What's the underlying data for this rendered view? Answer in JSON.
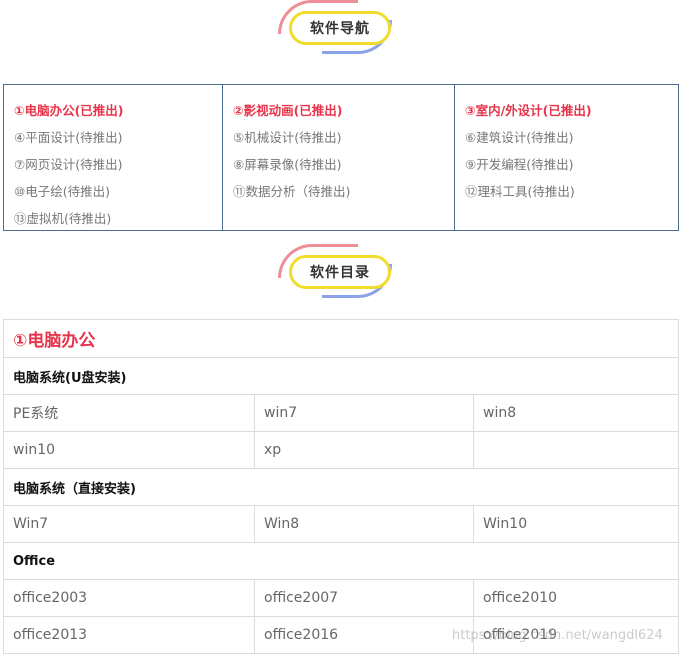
{
  "nav_section": {
    "title": "软件导航"
  },
  "nav_columns": [
    [
      "①电脑办公(已推出)",
      "④平面设计(待推出)",
      "⑦网页设计(待推出)",
      "⑩电子绘(待推出)",
      "⑬虚拟机(待推出)"
    ],
    [
      "②影视动画(已推出)",
      "⑤机械设计(待推出)",
      "⑧屏幕录像(待推出)",
      "⑪数据分析（待推出)"
    ],
    [
      "③室内/外设计(已推出)",
      "⑥建筑设计(待推出)",
      "⑨开发编程(待推出)",
      "⑫理科工具(待推出)"
    ]
  ],
  "dir_section": {
    "title": "软件目录"
  },
  "directory": {
    "title": "①电脑办公",
    "groups": [
      {
        "name": "电脑系统(U盘安装)",
        "rows": [
          [
            "PE系统",
            "win7",
            "win8"
          ],
          [
            "win10",
            "xp",
            ""
          ]
        ]
      },
      {
        "name": "电脑系统（直接安装)",
        "rows": [
          [
            "Win7",
            "Win8",
            "Win10"
          ]
        ]
      },
      {
        "name": "Office",
        "rows": [
          [
            "office2003",
            "office2007",
            "office2010"
          ],
          [
            "office2013",
            "office2016",
            "office2019"
          ]
        ]
      }
    ]
  },
  "watermark": "https://blog.csdn.net/wangdl624"
}
